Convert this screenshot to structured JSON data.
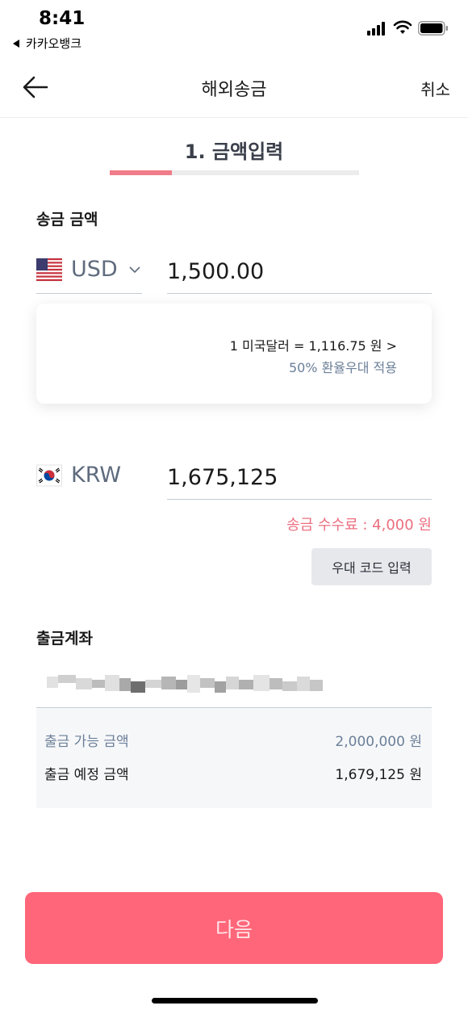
{
  "status_bar": {
    "time": "8:41",
    "back_app": "카카오뱅크"
  },
  "nav": {
    "title": "해외송금",
    "cancel_label": "취소"
  },
  "step": {
    "title": "1. 금액입력",
    "progress": 0.25
  },
  "send_amount": {
    "label": "송금 금액",
    "currency": "USD",
    "amount": "1,500.00"
  },
  "rate_card": {
    "rate_text": "1 미국달러 = 1,116.75 원 >",
    "discount_text": "50% 환율우대 적용"
  },
  "receive_amount": {
    "currency": "KRW",
    "amount": "1,675,125"
  },
  "fee": {
    "text": "송금 수수료 : 4,000 원"
  },
  "promo": {
    "button_label": "우대 코드 입력"
  },
  "account": {
    "label": "출금계좌",
    "available_label": "출금 가능 금액",
    "available_value": "2,000,000 원",
    "expected_label": "출금 예정 금액",
    "expected_value": "1,679,125 원"
  },
  "next_button": {
    "label": "다음"
  },
  "colors": {
    "accent": "#ff6679",
    "fee_text": "#ec6f80",
    "progress": "#f07c8a",
    "muted_blue": "#6b7f98"
  },
  "icons": {
    "back": "arrow-left-icon",
    "chevron": "chevron-down-icon",
    "us_flag": "us-flag-icon",
    "kr_flag": "kr-flag-icon"
  }
}
